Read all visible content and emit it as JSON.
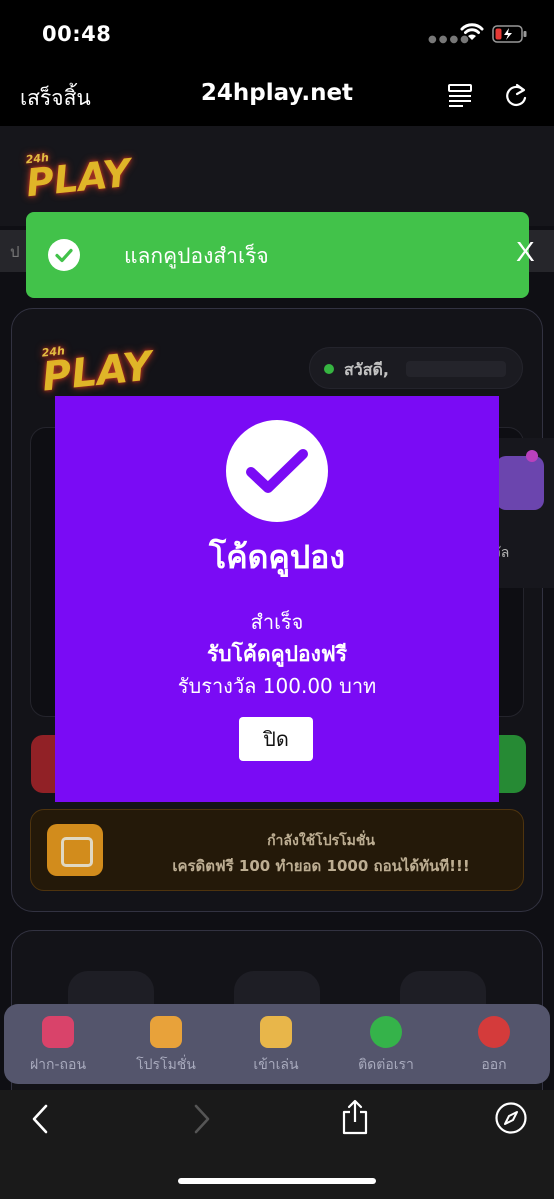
{
  "status_bar": {
    "time": "00:48"
  },
  "browser": {
    "done_label": "เสร็จสิ้น",
    "url": "24hplay.net"
  },
  "site": {
    "logo_small": "24h",
    "logo_word": "PLAY",
    "marquee_text": "ป",
    "greeting": "สวัสดี,",
    "side_reward_label": "งวัล",
    "promo": {
      "title": "กำลังใช้โปรโมชั่น",
      "text": "เครดิตฟรี 100 ทำยอด 1000 ถอนได้ทันที!!!"
    },
    "bottom_nav": [
      {
        "label": "ฝาก-ถอน",
        "icon": "wallet-icon",
        "color": "#d9436a"
      },
      {
        "label": "โปรโมชั่น",
        "icon": "gift-icon",
        "color": "#e8a23a"
      },
      {
        "label": "เข้าเล่น",
        "icon": "play-logo-icon",
        "color": "#e8b64a"
      },
      {
        "label": "ติดต่อเรา",
        "icon": "chat-icon",
        "color": "#35b34a"
      },
      {
        "label": "ออก",
        "icon": "power-icon",
        "color": "#d43b3b"
      }
    ]
  },
  "toast": {
    "message": "แลกคูปองสำเร็จ",
    "close_label": "X",
    "color": "#42c24a"
  },
  "modal": {
    "title": "โค้ดคูปอง",
    "line1": "สำเร็จ",
    "line2": "รับโค้ดคูปองฟรี",
    "line3": "รับรางวัล 100.00 บาท",
    "close_button": "ปิด",
    "color": "#7a0bf5"
  }
}
